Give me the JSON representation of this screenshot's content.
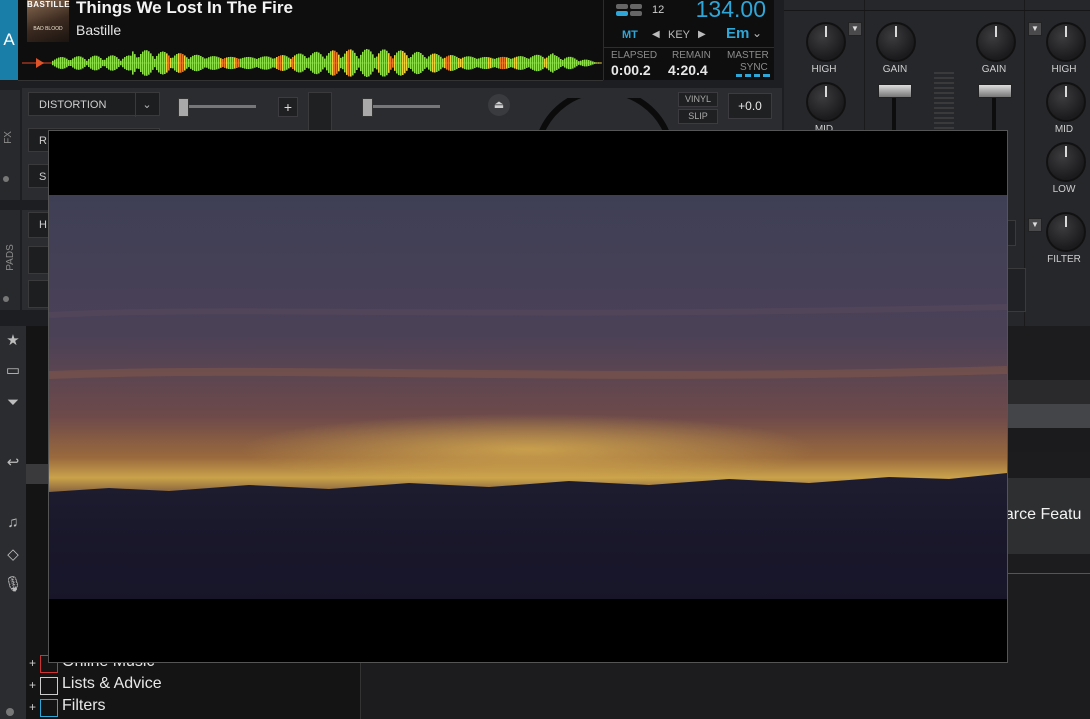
{
  "deck": {
    "letter": "A",
    "album_art": {
      "band": "BASTILLE",
      "album": "BAD BLOOD"
    },
    "title": "Things We Lost In The Fire",
    "artist": "Bastille",
    "pitch_range": "12",
    "bpm": "134.00",
    "mode_label": "MT",
    "key_label": "KEY",
    "key_value": "Em",
    "elapsed_label": "ELAPSED",
    "elapsed": "0:00.2",
    "remain_label": "REMAIN",
    "remain": "4:20.4",
    "master_label": "MASTER",
    "sync_label": "SYNC",
    "accent_color": "#2fa6d8"
  },
  "fx": {
    "strip_label": "FX",
    "effect_1": "DISTORTION",
    "effect_2_initial": "R",
    "effect_3_initial": "S",
    "add_label": "+",
    "vinyl_label": "VINYL",
    "slip_label": "SLIP",
    "pitch_value": "+0.0"
  },
  "pads": {
    "strip_label": "PADS",
    "mode_initial": "H"
  },
  "mixer": {
    "left_eq": [
      "HIGH",
      "MID"
    ],
    "gain_left": "GAIN",
    "gain_right": "GAIN",
    "right_eq": [
      "HIGH",
      "MID",
      "LOW"
    ],
    "filter_label": "FILTER"
  },
  "browser": {
    "tree_items": [
      {
        "label": "Online Music",
        "icon": "online-music-icon"
      },
      {
        "label": "Lists & Advice",
        "icon": "list-icon"
      },
      {
        "label": "Filters",
        "icon": "filter-folder-icon"
      }
    ],
    "partial_text": "earce Featu"
  },
  "video": {
    "description_colors": {
      "sky_top": "#3e3f55",
      "horizon": "#caa24a",
      "ground": "#17162a"
    }
  }
}
